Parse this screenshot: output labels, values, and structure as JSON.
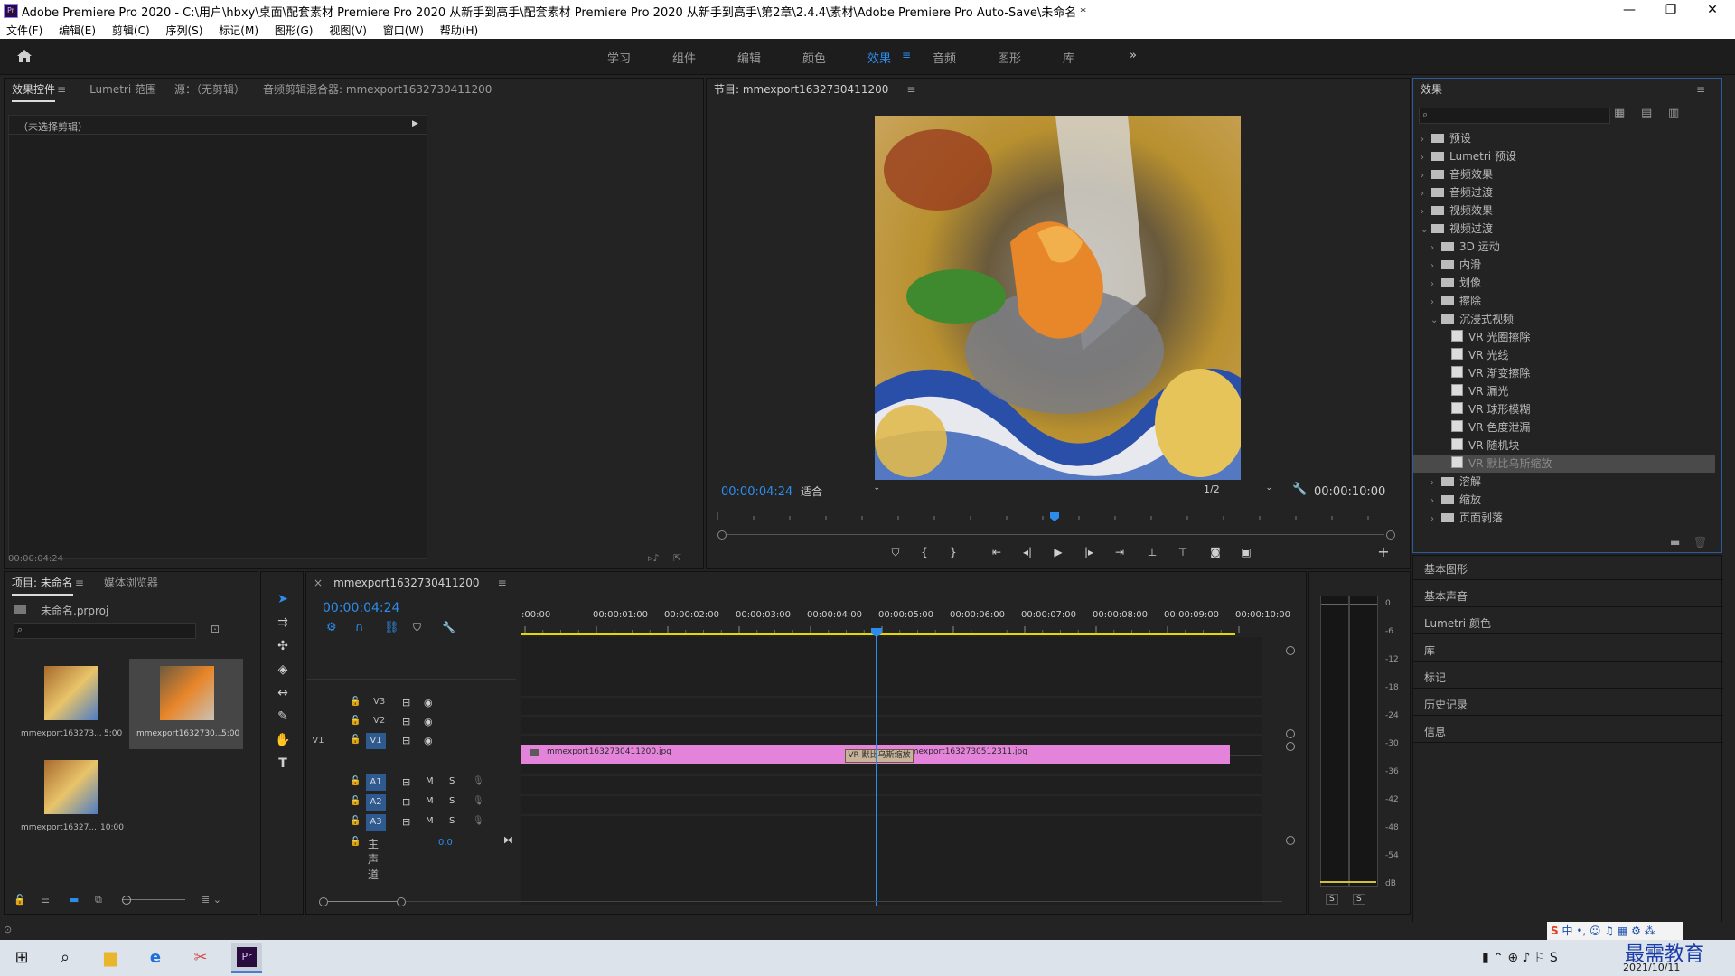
{
  "window": {
    "title": "Adobe Premiere Pro 2020 - C:\\用户\\hbxy\\桌面\\配套素材 Premiere Pro 2020 从新手到高手\\配套素材 Premiere Pro 2020 从新手到高手\\第2章\\2.4.4\\素材\\Adobe Premiere Pro Auto-Save\\未命名 *",
    "logo": "Pr",
    "minimize": "—",
    "maximize": "❐",
    "close": "✕"
  },
  "menu": [
    "文件(F)",
    "编辑(E)",
    "剪辑(C)",
    "序列(S)",
    "标记(M)",
    "图形(G)",
    "视图(V)",
    "窗口(W)",
    "帮助(H)"
  ],
  "workspaces": [
    "学习",
    "组件",
    "编辑",
    "颜色",
    "效果",
    "音频",
    "图形",
    "库"
  ],
  "workspace_active": "效果",
  "workspace_more": "»",
  "source_panel": {
    "tabs": [
      "效果控件",
      "Lumetri 范围",
      "源：（无剪辑）",
      "音频剪辑混合器: mmexport1632730411200"
    ],
    "no_clip": "（未选择剪辑）",
    "timecode": "00:00:04:24"
  },
  "program": {
    "tab": "节目: mmexport1632730411200",
    "timecode": "00:00:04:24",
    "fit": "适合",
    "quality": "1/2",
    "duration": "00:00:10:00"
  },
  "effects": {
    "title": "效果",
    "tree": [
      {
        "label": "预设",
        "level": 0,
        "type": "folder",
        "arrow": "›"
      },
      {
        "label": "Lumetri 预设",
        "level": 0,
        "type": "folder",
        "arrow": "›"
      },
      {
        "label": "音频效果",
        "level": 0,
        "type": "folder",
        "arrow": "›"
      },
      {
        "label": "音频过渡",
        "level": 0,
        "type": "folder",
        "arrow": "›"
      },
      {
        "label": "视频效果",
        "level": 0,
        "type": "folder",
        "arrow": "›"
      },
      {
        "label": "视频过渡",
        "level": 0,
        "type": "folder",
        "arrow": "⌄"
      },
      {
        "label": "3D 运动",
        "level": 1,
        "type": "folder",
        "arrow": "›"
      },
      {
        "label": "内滑",
        "level": 1,
        "type": "folder",
        "arrow": "›"
      },
      {
        "label": "划像",
        "level": 1,
        "type": "folder",
        "arrow": "›"
      },
      {
        "label": "擦除",
        "level": 1,
        "type": "folder",
        "arrow": "›"
      },
      {
        "label": "沉浸式视频",
        "level": 1,
        "type": "folder",
        "arrow": "⌄"
      },
      {
        "label": "VR 光圈擦除",
        "level": 2,
        "type": "fx",
        "arrow": ""
      },
      {
        "label": "VR 光线",
        "level": 2,
        "type": "fx",
        "arrow": ""
      },
      {
        "label": "VR 渐变擦除",
        "level": 2,
        "type": "fx",
        "arrow": ""
      },
      {
        "label": "VR 漏光",
        "level": 2,
        "type": "fx",
        "arrow": ""
      },
      {
        "label": "VR 球形模糊",
        "level": 2,
        "type": "fx",
        "arrow": ""
      },
      {
        "label": "VR 色度泄漏",
        "level": 2,
        "type": "fx",
        "arrow": ""
      },
      {
        "label": "VR 随机块",
        "level": 2,
        "type": "fx",
        "arrow": ""
      },
      {
        "label": "VR 默比乌斯缩放",
        "level": 2,
        "type": "fx",
        "arrow": "",
        "selected": true
      },
      {
        "label": "溶解",
        "level": 1,
        "type": "folder",
        "arrow": "›"
      },
      {
        "label": "缩放",
        "level": 1,
        "type": "folder",
        "arrow": "›"
      },
      {
        "label": "页面剥落",
        "level": 1,
        "type": "folder",
        "arrow": "›"
      }
    ]
  },
  "side_panels": [
    "基本图形",
    "基本声音",
    "Lumetri 颜色",
    "库",
    "标记",
    "历史记录",
    "信息"
  ],
  "project": {
    "tabs": [
      "项目: 未命名",
      "媒体浏览器"
    ],
    "file": "未命名.prproj",
    "items": [
      {
        "name": "mmexport163273...",
        "duration": "5:00"
      },
      {
        "name": "mmexport1632730...",
        "duration": "5:00"
      },
      {
        "name": "mmexport16327...",
        "duration": "10:00"
      }
    ]
  },
  "timeline": {
    "tab": "mmexport1632730411200",
    "close": "×",
    "timecode": "00:00:04:24",
    "ruler": [
      ":00:00",
      "00:00:01:00",
      "00:00:02:00",
      "00:00:03:00",
      "00:00:04:00",
      "00:00:05:00",
      "00:00:06:00",
      "00:00:07:00",
      "00:00:08:00",
      "00:00:09:00",
      "00:00:10:00"
    ],
    "tracks": {
      "video": [
        "V3",
        "V2",
        "V1"
      ],
      "audio": [
        "A1",
        "A2",
        "A3"
      ],
      "v1_source": "V1",
      "master": "主声道",
      "master_value": "0.0",
      "mute": "M",
      "solo": "S"
    },
    "clips": [
      {
        "label": "mmexport1632730411200.jpg"
      },
      {
        "label": "mmexport1632730512311.jpg"
      }
    ],
    "transition": "VR 默比乌斯缩放"
  },
  "meter": {
    "labels": [
      "0",
      "-6",
      "-12",
      "-18",
      "-24",
      "-30",
      "-36",
      "-42",
      "-48",
      "-54",
      "dB"
    ],
    "solo": [
      "S",
      "S"
    ]
  },
  "taskbar": {
    "ime": "中",
    "date": "2021/10/11",
    "watermark": "最需教育"
  },
  "colors": {
    "accent": "#2d8ceb",
    "clip": "#e383d9",
    "workarea": "#e5d800"
  }
}
